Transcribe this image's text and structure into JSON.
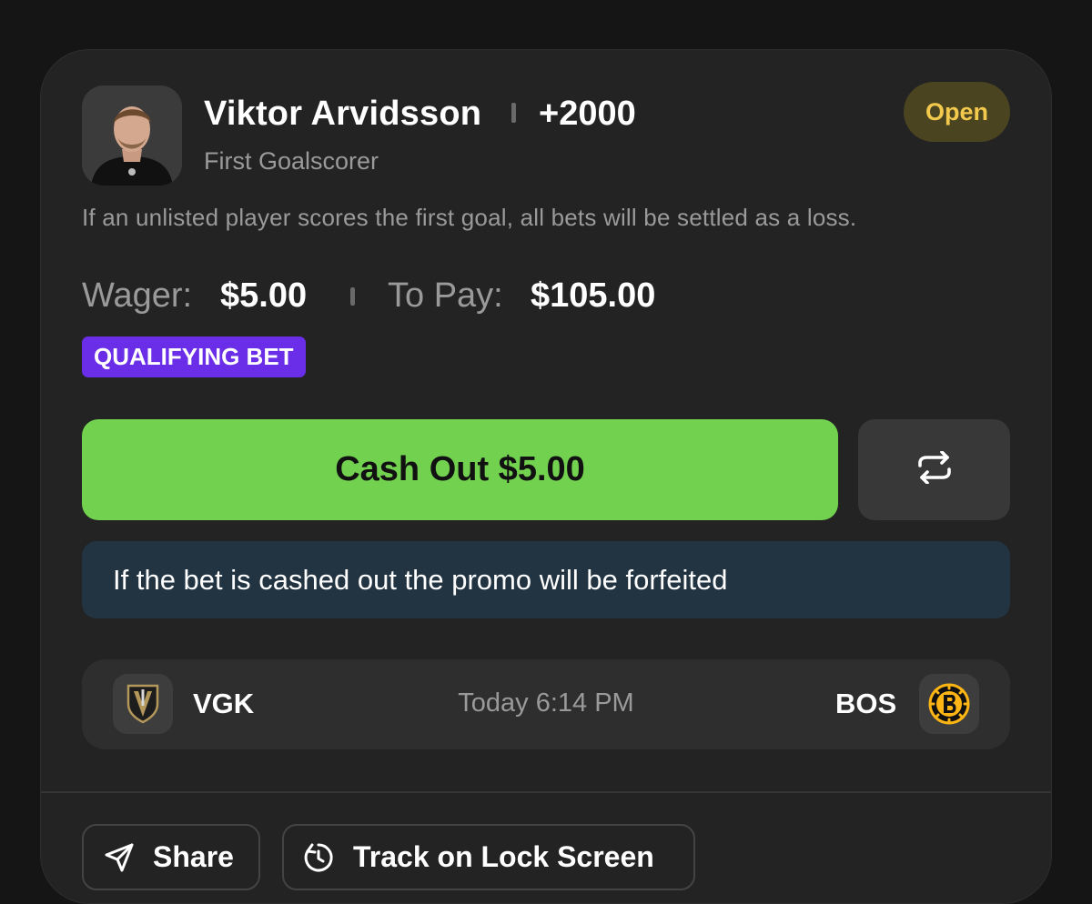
{
  "bet": {
    "player_name": "Viktor Arvidsson",
    "odds": "+2000",
    "market": "First Goalscorer",
    "status": "Open",
    "disclaimer": "If an unlisted player scores the first goal, all bets will be settled as a loss.",
    "wager_label": "Wager:",
    "wager_value": "$5.00",
    "to_pay_label": "To Pay:",
    "to_pay_value": "$105.00",
    "promo_tag": "QUALIFYING BET"
  },
  "actions": {
    "cash_out_label": "Cash Out $5.00",
    "swap_icon": "repeat-icon",
    "info_message": "If the bet is cashed out the promo will be forfeited"
  },
  "game": {
    "home_team": "VGK",
    "away_team": "BOS",
    "time": "Today 6:14 PM",
    "home_logo": "vegas-golden-knights-logo",
    "away_logo": "boston-bruins-logo"
  },
  "footer": {
    "share_label": "Share",
    "share_icon": "send-icon",
    "track_label": "Track on Lock Screen",
    "track_icon": "clock-icon"
  },
  "colors": {
    "background": "#151515",
    "card": "#232323",
    "cash_out": "#72d14f",
    "status_text": "#f2c94c",
    "status_bg": "#4a4421",
    "promo": "#6a2ee8",
    "info_banner": "#223341"
  }
}
